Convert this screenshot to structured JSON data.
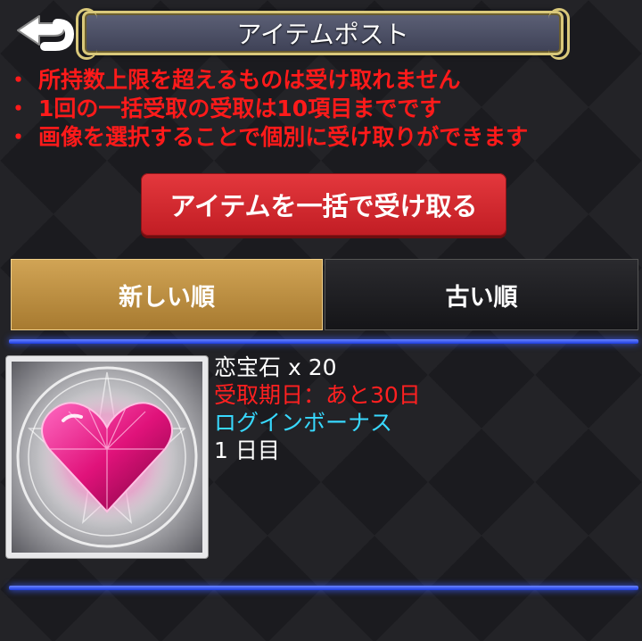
{
  "header": {
    "title": "アイテムポスト",
    "back_icon": "back-arrow-icon"
  },
  "notices": [
    "所持数上限を超えるものは受け取れません",
    "1回の一括受取の受取は10項目までです",
    "画像を選択することで個別に受け取りができます"
  ],
  "notice_bullet": "・",
  "claim_all_label": "アイテムを一括で受け取る",
  "sort_tabs": {
    "newest": "新しい順",
    "oldest": "古い順",
    "selected": "newest"
  },
  "items": [
    {
      "name": "恋宝石 x 20",
      "expiry": "受取期日：あと30日",
      "source": "ログインボーナス",
      "day": "1 日目",
      "icon": "heart-gem-icon"
    }
  ],
  "colors": {
    "notice": "#ff1a1a",
    "claim_button": "#d32a30",
    "selected_tab": "#c09046",
    "divider": "#3a5cff",
    "source_text": "#38d9ff"
  }
}
